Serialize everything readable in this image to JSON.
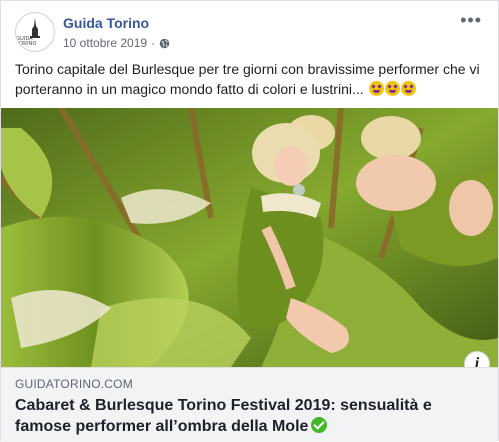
{
  "post": {
    "page_name": "Guida Torino",
    "avatar_text": "GUIDA\nTORINO",
    "date": "10 ottobre 2019",
    "separator": "·",
    "privacy_icon": "globe-icon",
    "more_icon": "more-horizontal-icon",
    "more_label": "•••",
    "text": "Torino capitale del Burlesque per tre giorni con bravissime performer che vi porteranno in un magico mondo fatto di colori e lustrini...",
    "emojis": [
      "star-struck-emoji",
      "star-struck-emoji",
      "star-struck-emoji"
    ]
  },
  "link_preview": {
    "domain": "GUIDATORINO.COM",
    "title": "Cabaret & Burlesque Torino Festival 2019: sensualità e famose performer all’ombra della Mole",
    "verified_icon": "green-check-icon",
    "info_icon": "info-icon",
    "info_label": "i"
  },
  "colors": {
    "page_name": "#365899",
    "dress_green": "#7ea028",
    "link_bg": "#f2f3f5",
    "verified": "#42b72a"
  }
}
